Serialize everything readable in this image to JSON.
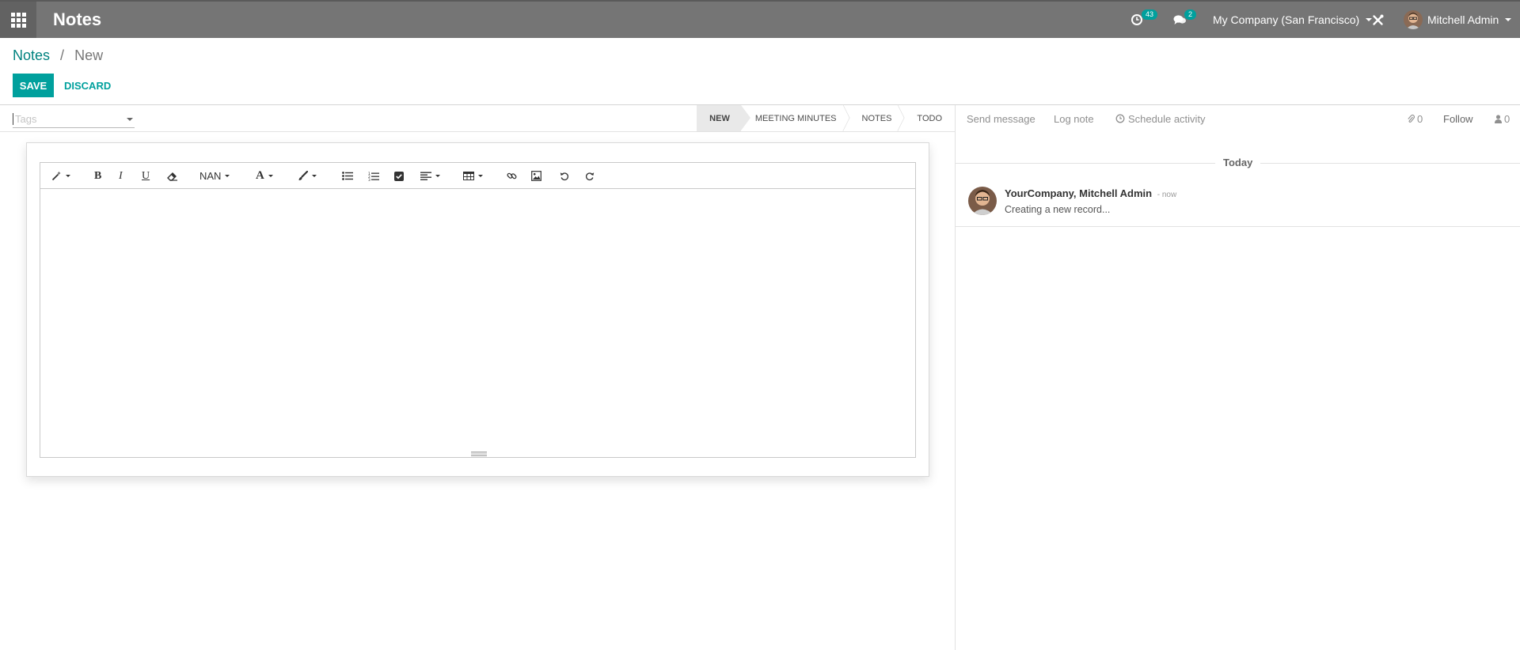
{
  "navbar": {
    "app_name": "Notes",
    "activity_count": "43",
    "messages_count": "2",
    "company": "My Company (San Francisco)",
    "user": "Mitchell Admin"
  },
  "breadcrumb": {
    "parent": "Notes",
    "separator": "/",
    "current": "New"
  },
  "buttons": {
    "save": "SAVE",
    "discard": "DISCARD"
  },
  "form": {
    "tags_placeholder": "Tags",
    "stages": [
      {
        "label": "NEW",
        "active": true
      },
      {
        "label": "MEETING MINUTES",
        "active": false
      },
      {
        "label": "NOTES",
        "active": false
      },
      {
        "label": "TODO",
        "active": false
      }
    ]
  },
  "editor_toolbar": {
    "font_size": "NAN"
  },
  "chatter": {
    "send_message": "Send message",
    "log_note": "Log note",
    "schedule_activity": "Schedule activity",
    "attachments_count": "0",
    "follow": "Follow",
    "followers_count": "0",
    "date_separator": "Today",
    "message": {
      "author": "YourCompany, Mitchell Admin",
      "date": "- now",
      "body": "Creating a new record..."
    }
  },
  "colors": {
    "navbar": "#757575",
    "primary": "#00a09d",
    "link": "#00827f"
  }
}
